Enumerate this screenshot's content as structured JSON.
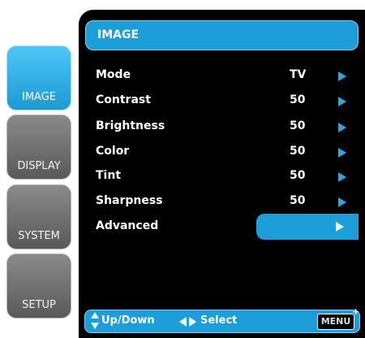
{
  "header": {
    "title": "IMAGE"
  },
  "tabs": [
    {
      "label": "IMAGE",
      "active": true
    },
    {
      "label": "DISPLAY",
      "active": false
    },
    {
      "label": "SYSTEM",
      "active": false
    },
    {
      "label": "SETUP",
      "active": false
    }
  ],
  "settings": [
    {
      "name": "Mode",
      "value": "TV"
    },
    {
      "name": "Contrast",
      "value": "50"
    },
    {
      "name": "Brightness",
      "value": "50"
    },
    {
      "name": "Color",
      "value": "50"
    },
    {
      "name": "Tint",
      "value": "50"
    },
    {
      "name": "Sharpness",
      "value": "50"
    },
    {
      "name": "Advanced",
      "value": ""
    }
  ],
  "footer": {
    "updown_label": "Up/Down",
    "select_label": "Select",
    "menu_label": "MENU"
  },
  "icons": {
    "updown": "up-down-arrows-icon",
    "leftright": "left-right-arrows-icon",
    "row_arrow": "right-triangle-icon",
    "plus": "plus-icon"
  },
  "colors": {
    "accent": "#1e9ed8",
    "tab_inactive": "#6e6e6e",
    "panel_bg": "#000000"
  }
}
